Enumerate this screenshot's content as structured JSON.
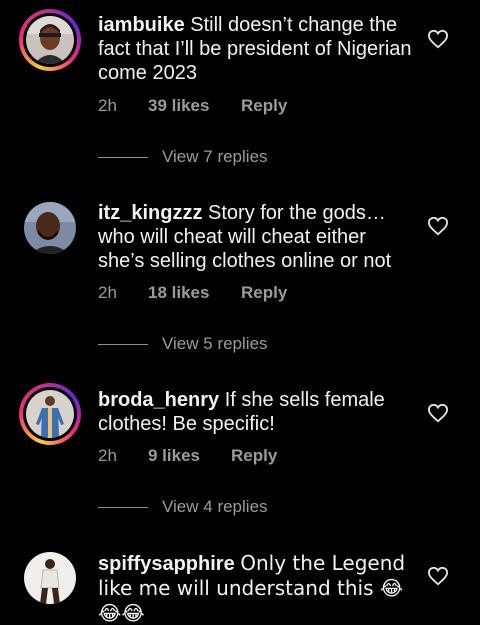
{
  "comments": [
    {
      "username": "iambuike",
      "text": "Still doesn’t change the fact that I’ll be president of Nigerian come 2023",
      "time": "2h",
      "likes": "39 likes",
      "reply": "Reply",
      "view_replies": "View 7 replies",
      "has_story_ring": true,
      "avatar_icon": "man-portrait-icon"
    },
    {
      "username": "itz_kingzzz",
      "text": "Story for the gods… who will cheat will cheat either she’s selling clothes online or not",
      "time": "2h",
      "likes": "18 likes",
      "reply": "Reply",
      "view_replies": "View 5 replies",
      "has_story_ring": false,
      "avatar_icon": "man-portrait-icon"
    },
    {
      "username": "broda_henry",
      "text": "If she sells female clothes! Be specific!",
      "time": "2h",
      "likes": "9 likes",
      "reply": "Reply",
      "view_replies": "View 4 replies",
      "has_story_ring": true,
      "avatar_icon": "man-standing-icon"
    },
    {
      "username": "spiffysapphire",
      "text": "Only the Legend like me will understand this 😂",
      "text_line3": "😂😂",
      "has_story_ring": false,
      "avatar_icon": "woman-posing-icon"
    }
  ],
  "colors": {
    "background": "#000000",
    "text": "#f2f2f2",
    "meta": "#9b9b9b",
    "ring_gradient": [
      "#f9ce34",
      "#ee2a7b",
      "#6228d7"
    ]
  }
}
